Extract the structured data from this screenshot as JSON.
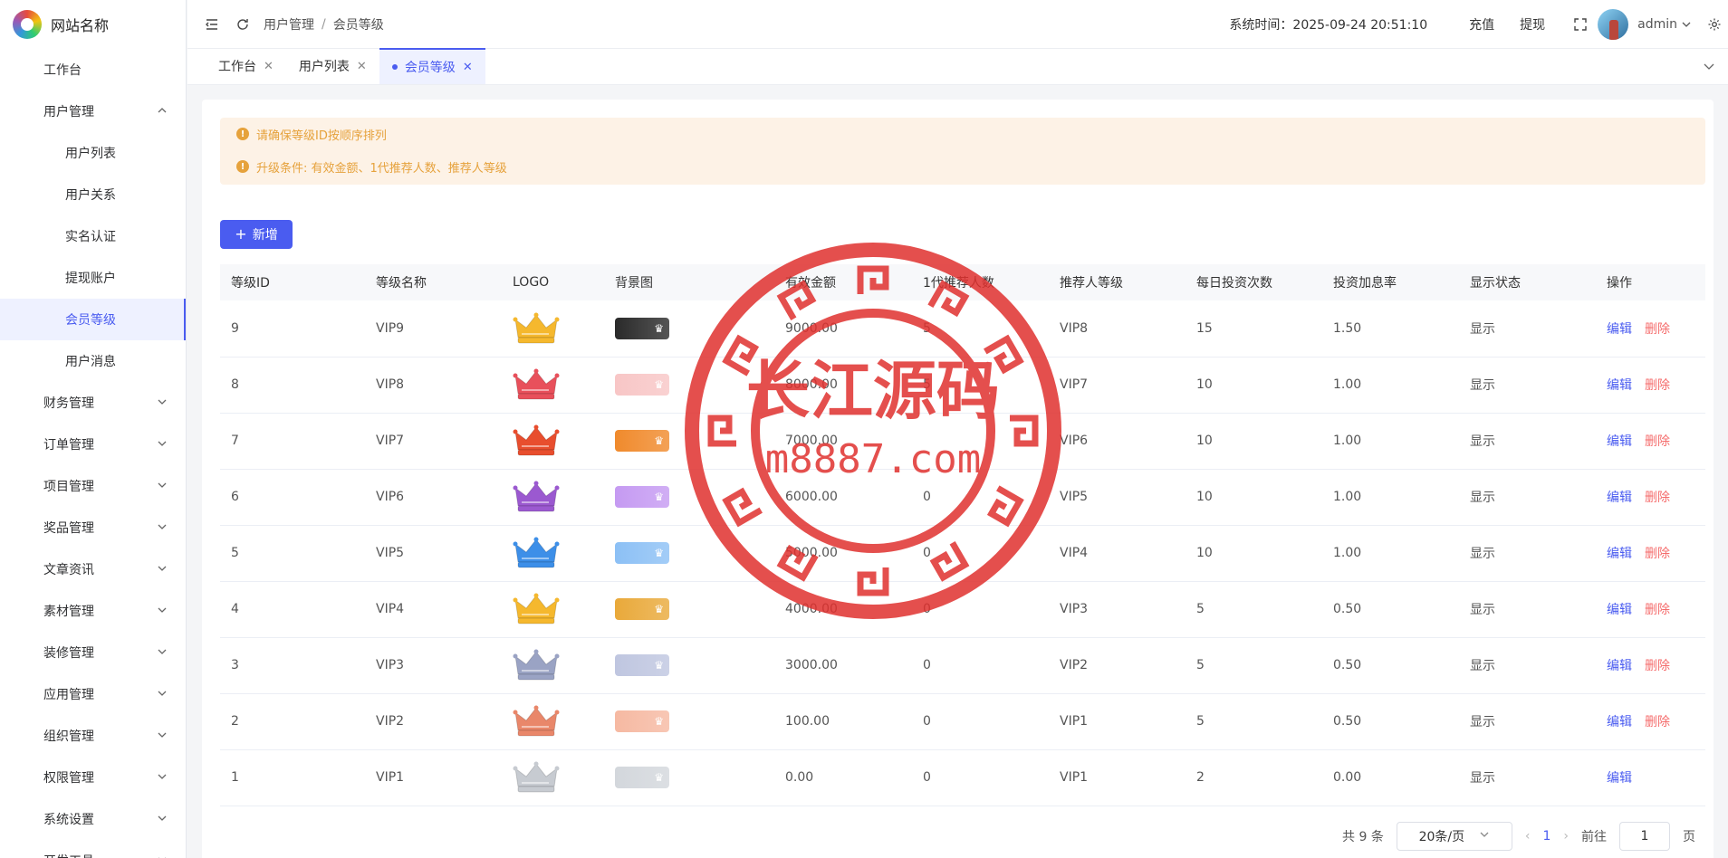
{
  "brand": {
    "name": "网站名称"
  },
  "sidebar": {
    "items": [
      {
        "label": "工作台",
        "icon": "monitor-icon"
      },
      {
        "label": "用户管理",
        "icon": "user-icon"
      },
      {
        "label": "用户列表",
        "icon": "user-list-icon"
      },
      {
        "label": "用户关系",
        "icon": "user-relation-icon"
      },
      {
        "label": "实名认证",
        "icon": "id-card-icon"
      },
      {
        "label": "提现账户",
        "icon": "folder-icon"
      },
      {
        "label": "会员等级",
        "icon": "rocket-icon"
      },
      {
        "label": "用户消息",
        "icon": "chat-icon"
      },
      {
        "label": "财务管理",
        "icon": "chart-icon"
      },
      {
        "label": "订单管理",
        "icon": "order-icon"
      },
      {
        "label": "项目管理",
        "icon": "project-icon"
      },
      {
        "label": "奖品管理",
        "icon": "gift-icon"
      },
      {
        "label": "文章资讯",
        "icon": "article-icon"
      },
      {
        "label": "素材管理",
        "icon": "image-icon"
      },
      {
        "label": "装修管理",
        "icon": "decorate-icon"
      },
      {
        "label": "应用管理",
        "icon": "app-icon"
      },
      {
        "label": "组织管理",
        "icon": "org-icon"
      },
      {
        "label": "权限管理",
        "icon": "permission-icon"
      },
      {
        "label": "系统设置",
        "icon": "gear-icon"
      },
      {
        "label": "开发工具",
        "icon": "tool-icon"
      }
    ]
  },
  "header": {
    "breadcrumb": [
      "用户管理",
      "会员等级"
    ],
    "system_time": "系统时间：2025-09-24 20:51:10",
    "recharge": "充值",
    "withdraw": "提现",
    "username": "admin"
  },
  "tabs": [
    "工作台",
    "用户列表",
    "会员等级"
  ],
  "alerts": [
    "请确保等级ID按顺序排列",
    "升级条件: 有效金额、1代推荐人数、推荐人等级"
  ],
  "add_button": "新增",
  "table": {
    "headers": [
      "等级ID",
      "等级名称",
      "LOGO",
      "背景图",
      "有效金额",
      "1代推荐人数",
      "推荐人等级",
      "每日投资次数",
      "投资加息率",
      "显示状态",
      "操作"
    ],
    "edit_label": "编辑",
    "delete_label": "删除",
    "rows": [
      {
        "id": "9",
        "name": "VIP9",
        "amount": "9000.00",
        "refs": "5",
        "ref_level": "VIP8",
        "daily": "15",
        "rate": "1.50",
        "status": "显示",
        "color": "#f5b82e",
        "bg": "#2a2a2a",
        "deletable": true
      },
      {
        "id": "8",
        "name": "VIP8",
        "amount": "8000.00",
        "refs": "5",
        "ref_level": "VIP7",
        "daily": "10",
        "rate": "1.00",
        "status": "显示",
        "color": "#e8505b",
        "bg": "#f8c6c6",
        "deletable": true
      },
      {
        "id": "7",
        "name": "VIP7",
        "amount": "7000.00",
        "refs": "",
        "ref_level": "VIP6",
        "daily": "10",
        "rate": "1.00",
        "status": "显示",
        "color": "#e84e2e",
        "bg": "#f08a2c",
        "deletable": true
      },
      {
        "id": "6",
        "name": "VIP6",
        "amount": "6000.00",
        "refs": "0",
        "ref_level": "VIP5",
        "daily": "10",
        "rate": "1.00",
        "status": "显示",
        "color": "#9b59d0",
        "bg": "#c59af2",
        "deletable": true
      },
      {
        "id": "5",
        "name": "VIP5",
        "amount": "5000.00",
        "refs": "0",
        "ref_level": "VIP4",
        "daily": "10",
        "rate": "1.00",
        "status": "显示",
        "color": "#3d8fe8",
        "bg": "#8cc0f5",
        "deletable": true
      },
      {
        "id": "4",
        "name": "VIP4",
        "amount": "4000.00",
        "refs": "0",
        "ref_level": "VIP3",
        "daily": "5",
        "rate": "0.50",
        "status": "显示",
        "color": "#f5b82e",
        "bg": "#e9a93a",
        "deletable": true
      },
      {
        "id": "3",
        "name": "VIP3",
        "amount": "3000.00",
        "refs": "0",
        "ref_level": "VIP2",
        "daily": "5",
        "rate": "0.50",
        "status": "显示",
        "color": "#9aa3c4",
        "bg": "#bfc6e0",
        "deletable": true
      },
      {
        "id": "2",
        "name": "VIP2",
        "amount": "100.00",
        "refs": "0",
        "ref_level": "VIP1",
        "daily": "5",
        "rate": "0.50",
        "status": "显示",
        "color": "#e9876a",
        "bg": "#f6b9a2",
        "deletable": true
      },
      {
        "id": "1",
        "name": "VIP1",
        "amount": "0.00",
        "refs": "0",
        "ref_level": "VIP1",
        "daily": "2",
        "rate": "0.00",
        "status": "显示",
        "color": "#c7cbd1",
        "bg": "#d3d7dc",
        "deletable": false
      }
    ]
  },
  "pagination": {
    "total": "共 9 条",
    "page_size": "20条/页",
    "current_page": "1",
    "goto_label": "前往",
    "goto_value": "1",
    "page_unit": "页"
  },
  "watermark": {
    "title": "长江源码",
    "url": "m8887.com",
    "color": "#e0312f"
  }
}
